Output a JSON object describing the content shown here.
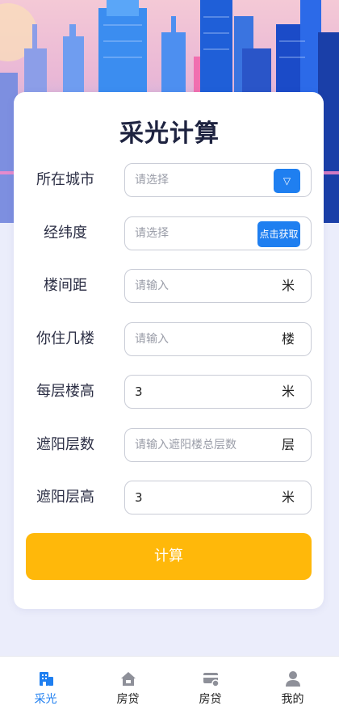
{
  "title": "采光计算",
  "colors": {
    "accent": "#1f7ff0",
    "calc_button": "#ffb80a",
    "text_dark": "#1e2340"
  },
  "form": {
    "city": {
      "label": "所在城市",
      "placeholder": "请选择",
      "dropdown_icon": "▽"
    },
    "coords": {
      "label": "经纬度",
      "placeholder": "请选择",
      "button_label": "点击获取"
    },
    "spacing": {
      "label": "楼间距",
      "placeholder": "请输入",
      "unit": "米"
    },
    "floor": {
      "label": "你住几楼",
      "placeholder": "请输入",
      "unit": "楼"
    },
    "floor_height": {
      "label": "每层楼高",
      "value": "3",
      "unit": "米"
    },
    "shade_floors": {
      "label": "遮阳层数",
      "placeholder": "请输入遮阳楼总层数",
      "unit": "层"
    },
    "shade_height": {
      "label": "遮阳层高",
      "value": "3",
      "unit": "米"
    }
  },
  "calc_button": "计算",
  "tabbar": {
    "items": [
      {
        "label": "采光",
        "icon": "building-icon",
        "active": true
      },
      {
        "label": "房贷",
        "icon": "house-icon",
        "active": false
      },
      {
        "label": "房贷",
        "icon": "card-icon",
        "active": false
      },
      {
        "label": "我的",
        "icon": "user-icon",
        "active": false
      }
    ]
  }
}
